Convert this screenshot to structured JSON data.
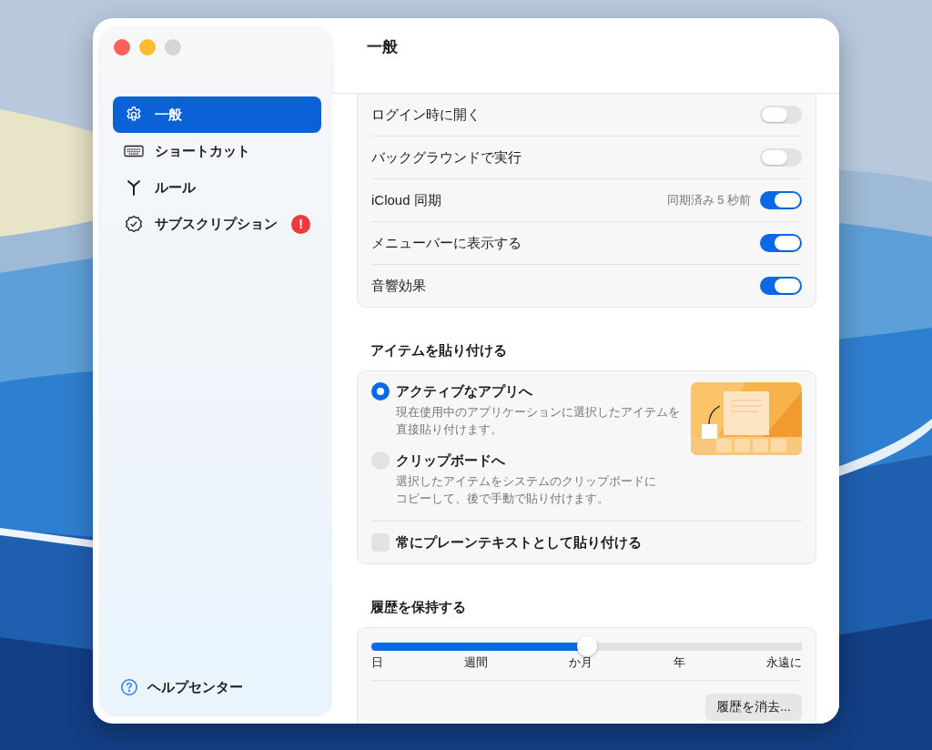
{
  "window": {
    "title": "一般"
  },
  "sidebar": {
    "items": [
      {
        "label": "一般",
        "kind": "gear",
        "selected": true
      },
      {
        "label": "ショートカット",
        "kind": "keyboard",
        "selected": false
      },
      {
        "label": "ルール",
        "kind": "branch",
        "selected": false
      },
      {
        "label": "サブスクリプション",
        "kind": "badge",
        "selected": false,
        "alert": "!"
      }
    ],
    "help": {
      "label": "ヘルプセンター"
    }
  },
  "toggles": [
    {
      "label": "ログイン時に開く",
      "on": false
    },
    {
      "label": "バックグラウンドで実行",
      "on": false
    },
    {
      "label": "iCloud 同期",
      "on": true,
      "status": "同期済み 5 秒前"
    },
    {
      "label": "メニューバーに表示する",
      "on": true
    },
    {
      "label": "音響効果",
      "on": true
    }
  ],
  "paste": {
    "title": "アイテムを貼り付ける",
    "options": [
      {
        "label": "アクティブなアプリへ",
        "selected": true,
        "description_lines": [
          "現在使用中のアプリケーションに選択したアイテムを",
          "直接貼り付けます。"
        ]
      },
      {
        "label": "クリップボードへ",
        "selected": false,
        "description_lines": [
          "選択したアイテムをシステムのクリップボードに",
          "コピーして、後で手動で貼り付けます。"
        ]
      }
    ],
    "plain_text": {
      "label": "常にプレーンテキストとして貼り付ける",
      "checked": false
    }
  },
  "history": {
    "title": "履歴を保持する",
    "slider": {
      "level": 0.5,
      "ticks": [
        "日",
        "週間",
        "か月",
        "年",
        "永遠に"
      ]
    },
    "button": "履歴を消去..."
  }
}
